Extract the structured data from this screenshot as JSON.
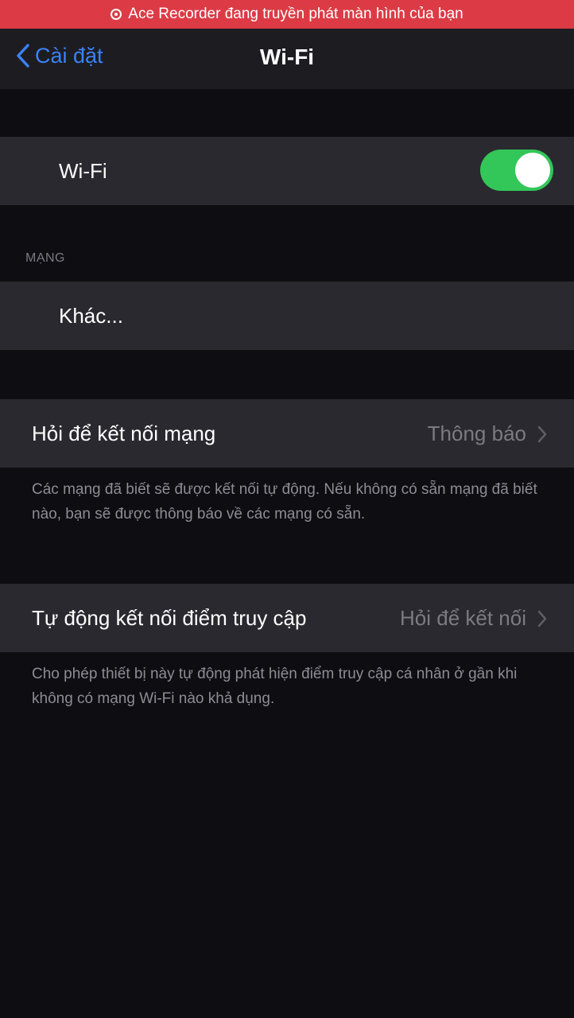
{
  "recording_banner": {
    "text": "Ace Recorder đang truyền phát màn hình của bạn",
    "color": "#dc3b45"
  },
  "nav": {
    "back_label": "Cài đặt",
    "title": "Wi-Fi"
  },
  "wifi_row": {
    "label": "Wi-Fi",
    "toggle_on": true,
    "toggle_color": "#33c659"
  },
  "networks_section": {
    "header": "MẠNG",
    "other_label": "Khác..."
  },
  "ask_to_join": {
    "label": "Hỏi để kết nối mạng",
    "value": "Thông báo",
    "footnote": "Các mạng đã biết sẽ được kết nối tự động. Nếu không có sẵn mạng đã biết nào, bạn sẽ được thông báo về các mạng có sẵn."
  },
  "auto_join_hotspot": {
    "label": "Tự động kết nối điểm truy cập",
    "value": "Hỏi để kết nối",
    "footnote": "Cho phép thiết bị này tự động phát hiện điểm truy cập cá nhân ở gần khi không có mạng Wi-Fi nào khả dụng."
  },
  "accent_color": "#3a82f7"
}
